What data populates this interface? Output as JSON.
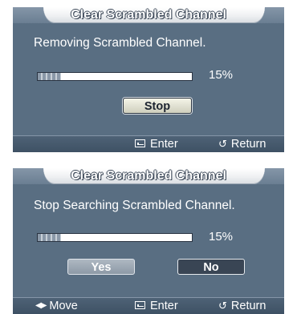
{
  "dialogs": [
    {
      "title": "Clear Scrambled Channel",
      "message": "Removing Scrambled Channel.",
      "progress_percent": 15,
      "progress_label": "15%",
      "buttons": [
        {
          "label": "Stop",
          "state": "focused"
        }
      ],
      "footer": [
        {
          "icon": "enter-icon",
          "label": "Enter"
        },
        {
          "icon": "return-icon",
          "label": "Return"
        }
      ]
    },
    {
      "title": "Clear Scrambled Channel",
      "message": "Stop Searching Scrambled Channel.",
      "progress_percent": 15,
      "progress_label": "15%",
      "buttons": [
        {
          "label": "Yes",
          "state": "normal"
        },
        {
          "label": "No",
          "state": "selected"
        }
      ],
      "footer": [
        {
          "icon": "move-icon",
          "label": "Move"
        },
        {
          "icon": "enter-icon",
          "label": "Enter"
        },
        {
          "icon": "return-icon",
          "label": "Return"
        }
      ]
    }
  ],
  "colors": {
    "panel_bg": "#596e82",
    "title_tab": "#eef0f2",
    "footer_bg": "#465a6e",
    "progress_fill": "#8a98a8"
  }
}
